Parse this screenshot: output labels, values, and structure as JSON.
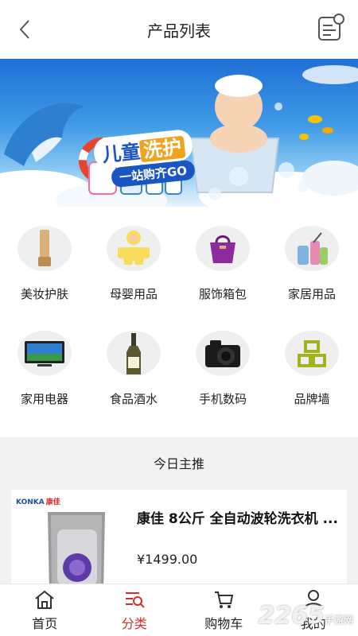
{
  "header": {
    "title": "产品列表"
  },
  "banner": {
    "line1_a": "儿童",
    "line1_b": "洗护",
    "line2": "一站购齐GO"
  },
  "categories": [
    {
      "label": "美妆护肤",
      "icon": "cosmetics-tube-icon"
    },
    {
      "label": "母婴用品",
      "icon": "baby-romper-icon"
    },
    {
      "label": "服饰箱包",
      "icon": "handbag-icon"
    },
    {
      "label": "家居用品",
      "icon": "cleaning-supplies-icon"
    },
    {
      "label": "家用电器",
      "icon": "tv-icon"
    },
    {
      "label": "食品酒水",
      "icon": "wine-bottle-icon"
    },
    {
      "label": "手机数码",
      "icon": "camera-icon"
    },
    {
      "label": "品牌墙",
      "icon": "brand-wall-icon"
    }
  ],
  "recommend": {
    "title": "今日主推"
  },
  "product": {
    "name": "康佳 8公斤 全自动波轮洗衣机 ...",
    "price": "¥1499.00",
    "brand": "KONKA",
    "brand_cn": "康佳"
  },
  "tabbar": {
    "items": [
      {
        "label": "首页",
        "active": false
      },
      {
        "label": "分类",
        "active": true
      },
      {
        "label": "购物车",
        "active": false
      },
      {
        "label": "我的",
        "active": false
      }
    ]
  },
  "watermark": {
    "text": "2265",
    "sub": "手游网"
  },
  "colors": {
    "accent": "#e02a2a",
    "brand_wall": "#a4b21e",
    "page_bg": "#f2f2f2"
  }
}
